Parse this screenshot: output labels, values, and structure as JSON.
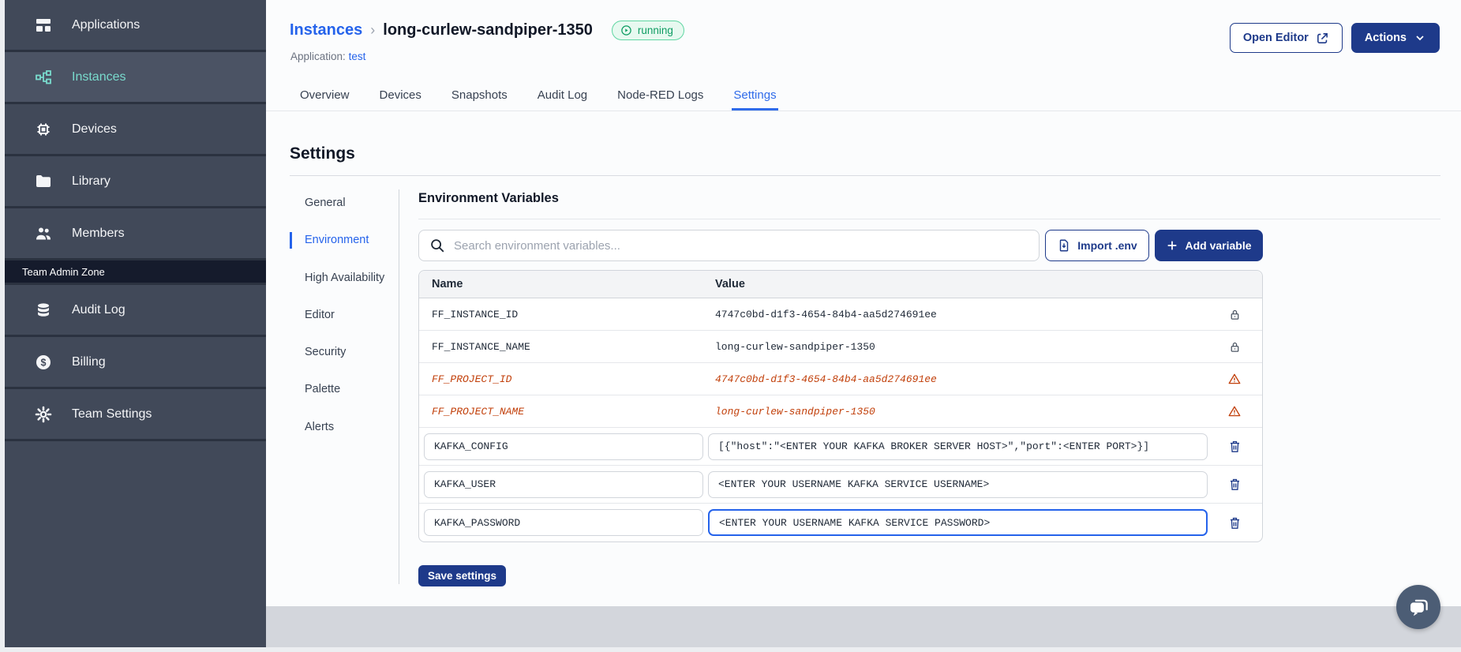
{
  "app": {
    "accent_blue": "#2563eb",
    "navy": "#1e3a8a",
    "sidebar_teal": "#79dbcd",
    "warning_orange": "#c2410c",
    "status_green": "#0f9d63"
  },
  "sidebar": {
    "items": [
      {
        "label": "Applications",
        "icon": "applications-icon"
      },
      {
        "label": "Instances",
        "icon": "instances-icon"
      },
      {
        "label": "Devices",
        "icon": "devices-icon"
      },
      {
        "label": "Library",
        "icon": "library-icon"
      },
      {
        "label": "Members",
        "icon": "members-icon"
      }
    ],
    "section_label": "Team Admin Zone",
    "admin_items": [
      {
        "label": "Audit Log",
        "icon": "audit-log-icon"
      },
      {
        "label": "Billing",
        "icon": "billing-icon"
      },
      {
        "label": "Team Settings",
        "icon": "team-settings-icon"
      }
    ]
  },
  "header": {
    "breadcrumb_parent": "Instances",
    "breadcrumb_separator": "›",
    "instance_name": "long-curlew-sandpiper-1350",
    "status_badge": "running",
    "application_label": "Application:",
    "application_name": "test",
    "open_editor_label": "Open Editor",
    "actions_label": "Actions"
  },
  "tabs": [
    "Overview",
    "Devices",
    "Snapshots",
    "Audit Log",
    "Node-RED Logs",
    "Settings"
  ],
  "settings": {
    "title": "Settings",
    "nav": [
      "General",
      "Environment",
      "High Availability",
      "Editor",
      "Security",
      "Palette",
      "Alerts"
    ]
  },
  "env": {
    "title": "Environment Variables",
    "search_placeholder": "Search environment variables...",
    "import_label": "Import .env",
    "add_label": "Add variable",
    "columns": {
      "name": "Name",
      "value": "Value"
    },
    "rows": [
      {
        "name": "FF_INSTANCE_ID",
        "value": "4747c0bd-d1f3-4654-84b4-aa5d274691ee",
        "type": "locked"
      },
      {
        "name": "FF_INSTANCE_NAME",
        "value": "long-curlew-sandpiper-1350",
        "type": "locked"
      },
      {
        "name": "FF_PROJECT_ID",
        "value": "4747c0bd-d1f3-4654-84b4-aa5d274691ee",
        "type": "deprecated"
      },
      {
        "name": "FF_PROJECT_NAME",
        "value": "long-curlew-sandpiper-1350",
        "type": "deprecated"
      },
      {
        "name": "KAFKA_CONFIG",
        "value": "[{\"host\":\"<ENTER YOUR KAFKA BROKER SERVER HOST>\",\"port\":<ENTER PORT>}]",
        "type": "editable"
      },
      {
        "name": "KAFKA_USER",
        "value": "<ENTER YOUR USERNAME KAFKA SERVICE USERNAME>",
        "type": "editable"
      },
      {
        "name": "KAFKA_PASSWORD",
        "value": "<ENTER YOUR USERNAME KAFKA SERVICE PASSWORD>",
        "type": "editable",
        "focused": true
      }
    ],
    "save_label": "Save settings"
  }
}
